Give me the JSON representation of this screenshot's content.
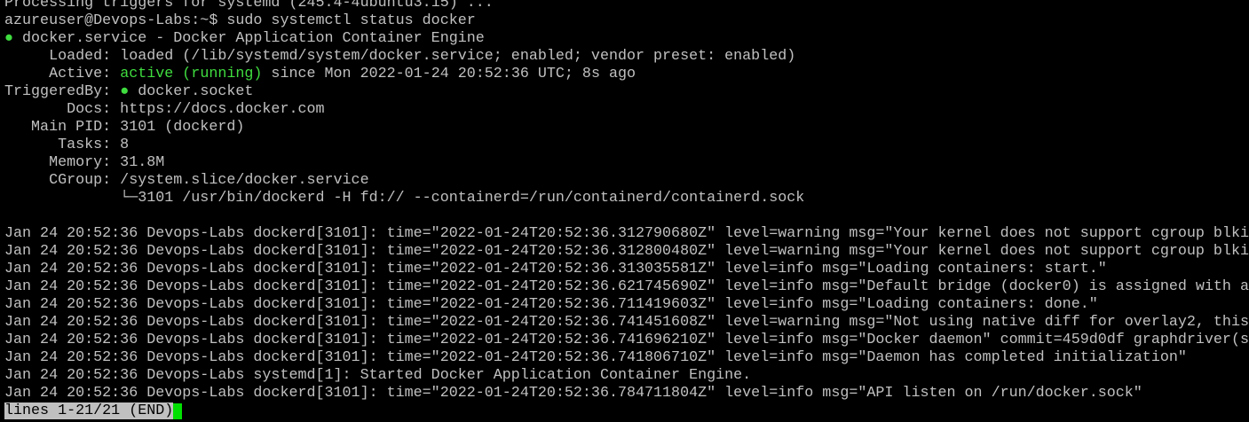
{
  "terminal": {
    "truncated_top": "Processing triggers for systemd (245.4-4ubuntu3.15) ...",
    "prompt_line": "azureuser@Devops-Labs:~$ sudo systemctl status docker",
    "service_bullet": "●",
    "service_line": " docker.service - Docker Application Container Engine",
    "loaded": "     Loaded: loaded (/lib/systemd/system/docker.service; enabled; vendor preset: enabled)",
    "active_label": "     Active: ",
    "active_state": "active (running)",
    "active_since": " since Mon 2022-01-24 20:52:36 UTC; 8s ago",
    "triggered_label": "TriggeredBy: ",
    "triggered_bullet": "●",
    "triggered_value": " docker.socket",
    "docs": "       Docs: https://docs.docker.com",
    "main_pid": "   Main PID: 3101 (dockerd)",
    "tasks": "      Tasks: 8",
    "memory": "     Memory: 31.8M",
    "cgroup": "     CGroup: /system.slice/docker.service",
    "cgroup_child": "             └─3101 /usr/bin/dockerd -H fd:// --containerd=/run/containerd/containerd.sock",
    "log_lines": [
      "Jan 24 20:52:36 Devops-Labs dockerd[3101]: time=\"2022-01-24T20:52:36.312790680Z\" level=warning msg=\"Your kernel does not support cgroup blkio",
      "Jan 24 20:52:36 Devops-Labs dockerd[3101]: time=\"2022-01-24T20:52:36.312800480Z\" level=warning msg=\"Your kernel does not support cgroup blkio",
      "Jan 24 20:52:36 Devops-Labs dockerd[3101]: time=\"2022-01-24T20:52:36.313035581Z\" level=info msg=\"Loading containers: start.\"",
      "Jan 24 20:52:36 Devops-Labs dockerd[3101]: time=\"2022-01-24T20:52:36.621745690Z\" level=info msg=\"Default bridge (docker0) is assigned with an",
      "Jan 24 20:52:36 Devops-Labs dockerd[3101]: time=\"2022-01-24T20:52:36.711419603Z\" level=info msg=\"Loading containers: done.\"",
      "Jan 24 20:52:36 Devops-Labs dockerd[3101]: time=\"2022-01-24T20:52:36.741451608Z\" level=warning msg=\"Not using native diff for overlay2, this",
      "Jan 24 20:52:36 Devops-Labs dockerd[3101]: time=\"2022-01-24T20:52:36.741696210Z\" level=info msg=\"Docker daemon\" commit=459d0df graphdriver(s)",
      "Jan 24 20:52:36 Devops-Labs dockerd[3101]: time=\"2022-01-24T20:52:36.741806710Z\" level=info msg=\"Daemon has completed initialization\"",
      "Jan 24 20:52:36 Devops-Labs systemd[1]: Started Docker Application Container Engine.",
      "Jan 24 20:52:36 Devops-Labs dockerd[3101]: time=\"2022-01-24T20:52:36.784711804Z\" level=info msg=\"API listen on /run/docker.sock\""
    ],
    "pager_status": "lines 1-21/21 (END)"
  },
  "colors": {
    "background": "#000000",
    "text": "#c0c0c0",
    "active_green": "#3fdc3f",
    "cursor": "#00e000"
  }
}
